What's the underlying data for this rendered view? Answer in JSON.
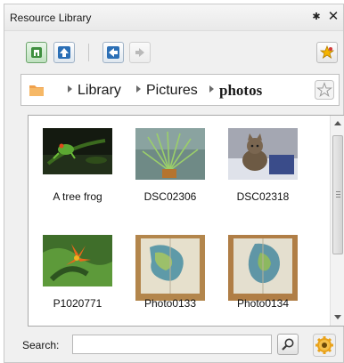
{
  "window": {
    "title": "Resource Library",
    "pin_glyph": "✱",
    "close_glyph": "✕"
  },
  "toolbar": {
    "buttons": [
      "home-icon",
      "up-arrow-icon",
      "back-arrow-icon",
      "forward-arrow-icon",
      "favorite-icon"
    ]
  },
  "breadcrumb": {
    "items": [
      "Library",
      "Pictures",
      "photos"
    ],
    "current": "photos"
  },
  "gallery": {
    "items": [
      {
        "label": "A tree frog"
      },
      {
        "label": "DSC02306"
      },
      {
        "label": "DSC02318"
      },
      {
        "label": "P1020771"
      },
      {
        "label": "Photo0133"
      },
      {
        "label": "Photo0134"
      }
    ]
  },
  "search": {
    "label": "Search:",
    "value": "",
    "placeholder": ""
  },
  "colors": {
    "accent": "#2b6fb6",
    "home_green": "#3f8f3f",
    "folder_orange": "#f0a04b"
  }
}
